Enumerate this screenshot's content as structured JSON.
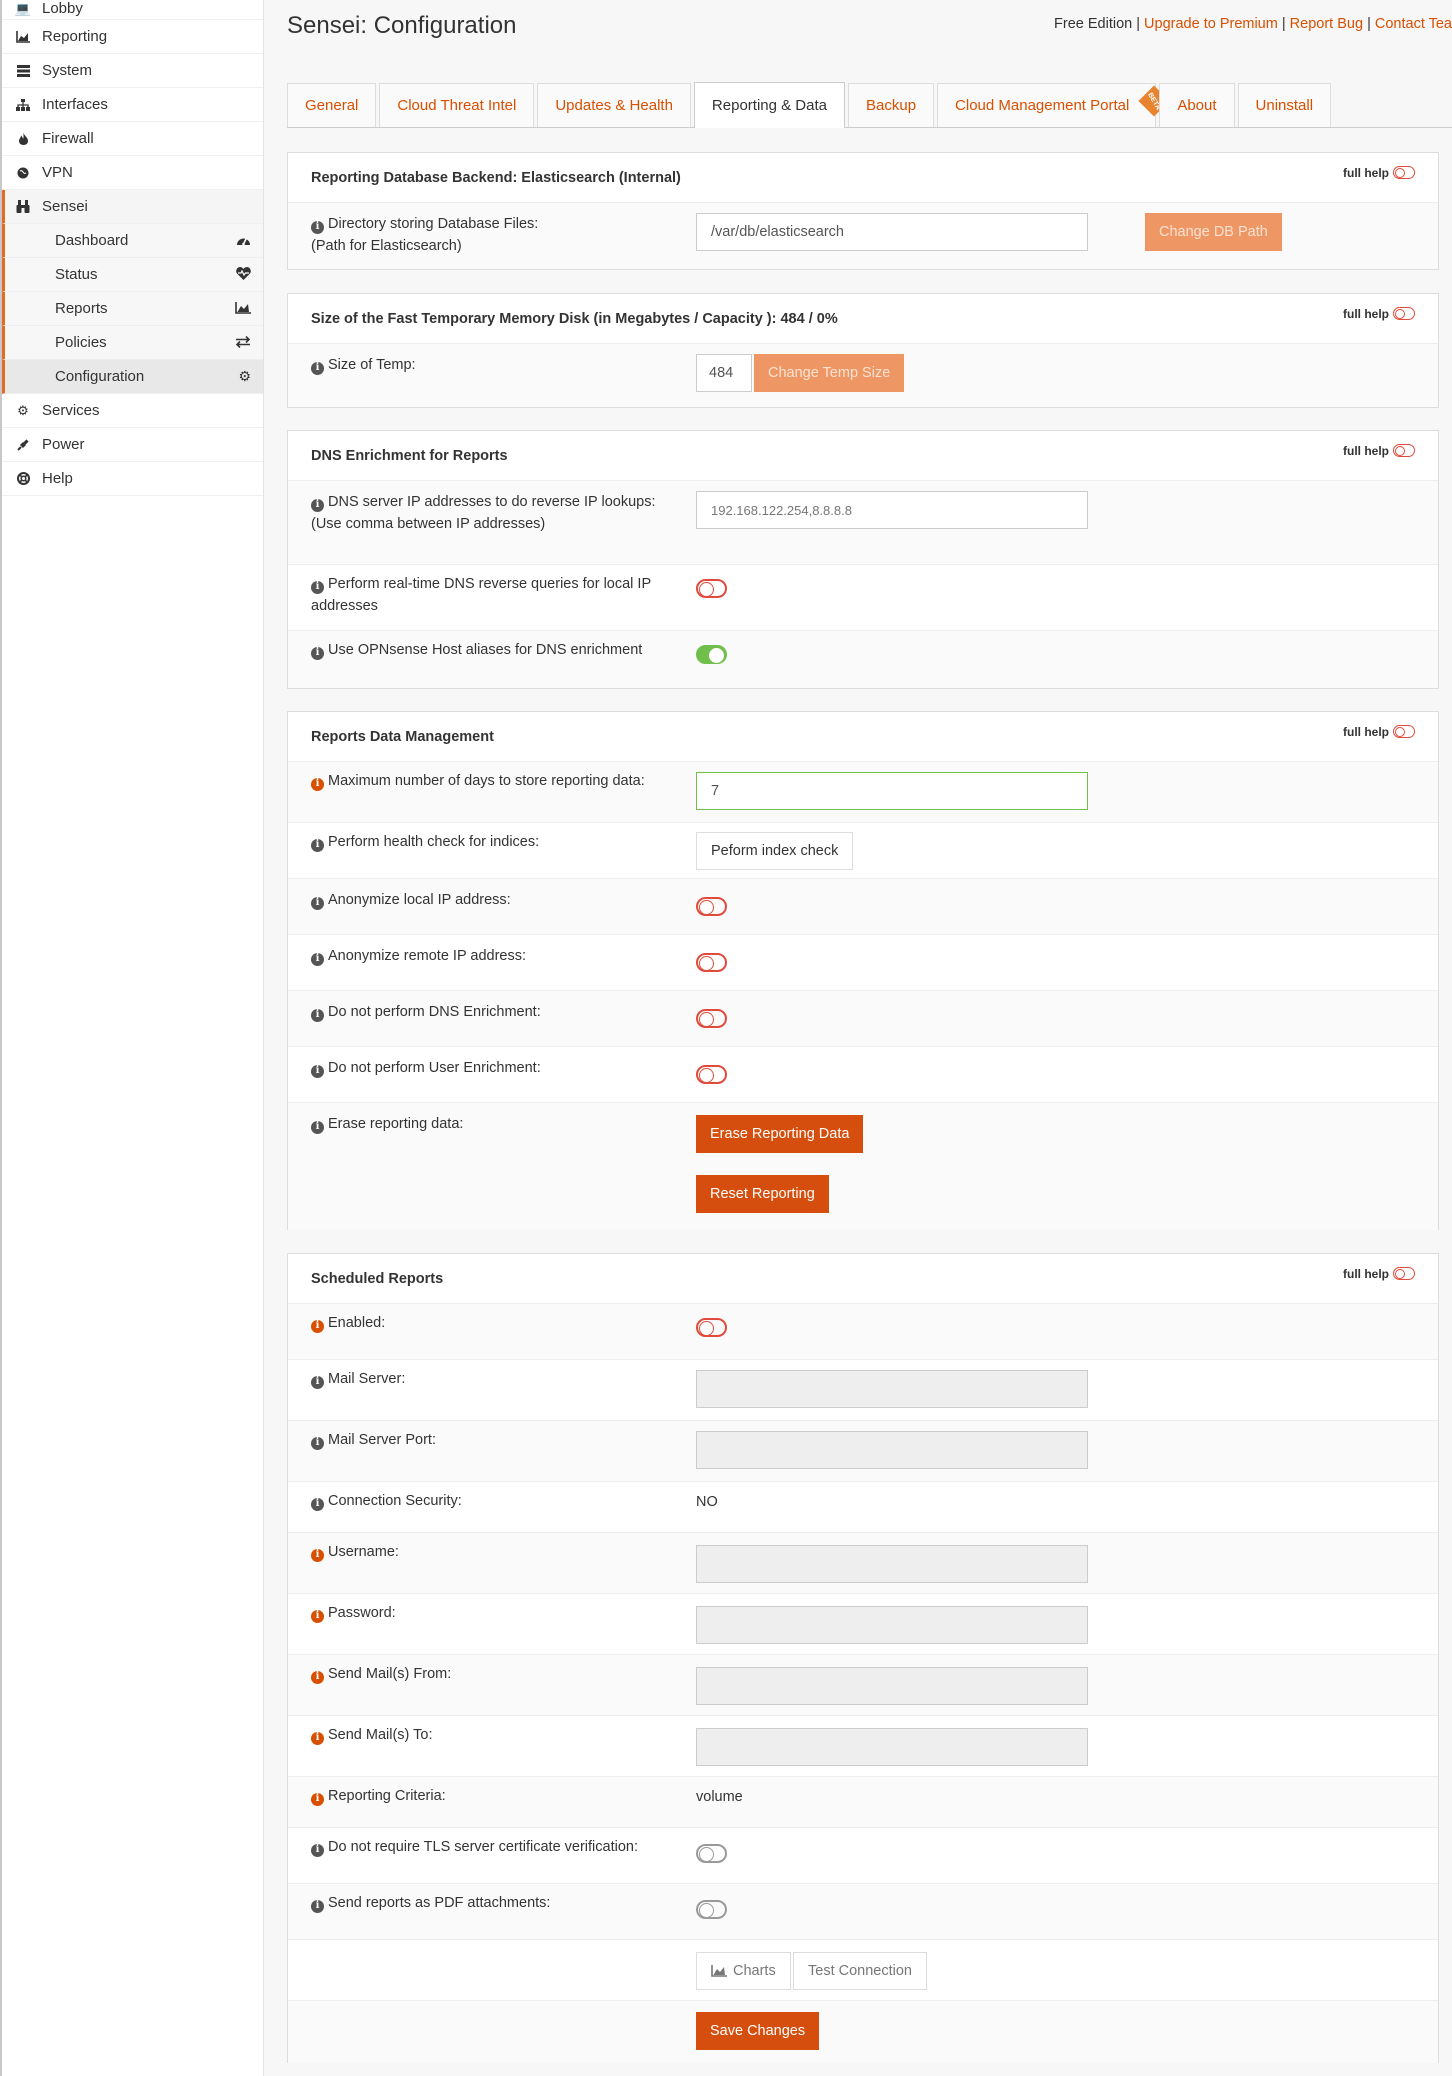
{
  "sidebar": {
    "items": [
      {
        "label": "Lobby",
        "icon": "laptop-icon"
      },
      {
        "label": "Reporting",
        "icon": "area-chart-icon"
      },
      {
        "label": "System",
        "icon": "server-icon"
      },
      {
        "label": "Interfaces",
        "icon": "sitemap-icon"
      },
      {
        "label": "Firewall",
        "icon": "fire-icon"
      },
      {
        "label": "VPN",
        "icon": "globe-icon"
      },
      {
        "label": "Sensei",
        "icon": "binoculars-icon"
      }
    ],
    "sensei_sub": [
      {
        "label": "Dashboard",
        "icon": "tachometer-icon"
      },
      {
        "label": "Status",
        "icon": "heartbeat-icon"
      },
      {
        "label": "Reports",
        "icon": "area-chart-icon"
      },
      {
        "label": "Policies",
        "icon": "exchange-icon"
      },
      {
        "label": "Configuration",
        "icon": "gear-icon"
      }
    ],
    "bottom_items": [
      {
        "label": "Services",
        "icon": "gear-icon"
      },
      {
        "label": "Power",
        "icon": "plug-icon"
      },
      {
        "label": "Help",
        "icon": "life-ring-icon"
      }
    ]
  },
  "header": {
    "title": "Sensei: Configuration",
    "edition": "Free Edition",
    "sep": "|",
    "links": [
      "Upgrade to Premium",
      "Report Bug",
      "Contact Tea"
    ]
  },
  "tabs": [
    "General",
    "Cloud Threat Intel",
    "Updates & Health",
    "Reporting & Data",
    "Backup",
    "Cloud Management Portal",
    "About",
    "Uninstall"
  ],
  "beta_badge": "BETA",
  "full_help": "full help",
  "db_panel": {
    "title": "Reporting Database Backend: Elasticsearch (Internal)",
    "label_line1": "Directory storing Database Files:",
    "label_line2": "(Path for Elasticsearch)",
    "value": "/var/db/elasticsearch",
    "button": "Change DB Path"
  },
  "temp_panel": {
    "title": "Size of the Fast Temporary Memory Disk (in Megabytes / Capacity ): 484 / 0%",
    "label": "Size of Temp:",
    "value": "484",
    "button": "Change Temp Size"
  },
  "dns_panel": {
    "title": "DNS Enrichment for Reports",
    "dns_label_line1": "DNS server IP addresses to do reverse IP lookups:",
    "dns_label_line2": "(Use comma between IP addresses)",
    "dns_value": "192.168.122.254,8.8.8.8",
    "realtime_label_line1": "Perform real-time DNS reverse queries for local IP",
    "realtime_label_line2": "addresses",
    "aliases_label": "Use OPNsense Host aliases for DNS enrichment"
  },
  "data_panel": {
    "title": "Reports Data Management",
    "max_days_label": "Maximum number of days to store reporting data:",
    "max_days_value": "7",
    "health_label": "Perform health check for indices:",
    "health_button": "Peform index check",
    "anon_local_label": "Anonymize local IP address:",
    "anon_remote_label": "Anonymize remote IP address:",
    "no_dns_label": "Do not perform DNS Enrichment:",
    "no_user_label": "Do not perform User Enrichment:",
    "erase_label": "Erase reporting data:",
    "erase_button": "Erase Reporting Data",
    "reset_button": "Reset Reporting"
  },
  "sched_panel": {
    "title": "Scheduled Reports",
    "enabled_label": "Enabled:",
    "mail_server_label": "Mail Server:",
    "mail_port_label": "Mail Server Port:",
    "conn_sec_label": "Connection Security:",
    "conn_sec_value": "NO",
    "username_label": "Username:",
    "password_label": "Password:",
    "from_label": "Send Mail(s) From:",
    "to_label": "Send Mail(s) To:",
    "criteria_label": "Reporting Criteria:",
    "criteria_value": "volume",
    "tls_label": "Do not require TLS server certificate verification:",
    "pdf_label": "Send reports as PDF attachments:",
    "charts_button": "Charts",
    "test_button": "Test Connection",
    "save_button": "Save Changes"
  },
  "colors": {
    "accent": "#d94f00",
    "button_orange": "#d64e0d",
    "button_disabled": "#ee9765",
    "toggle_off": "#e04b3b",
    "toggle_on": "#6fbf4a"
  }
}
